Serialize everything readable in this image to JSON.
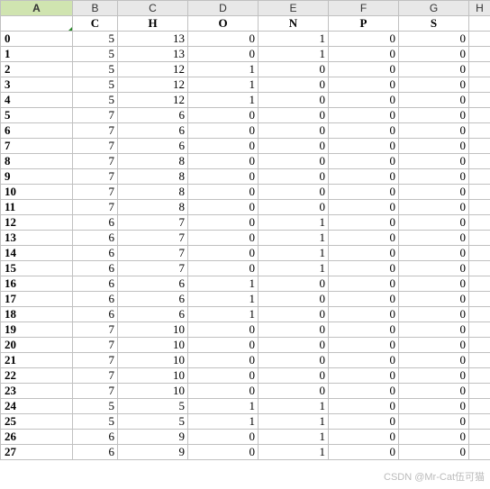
{
  "columns": [
    "A",
    "B",
    "C",
    "D",
    "E",
    "F",
    "G",
    "H"
  ],
  "data_headers": [
    "C",
    "H",
    "O",
    "N",
    "P",
    "S"
  ],
  "rows": [
    {
      "idx": "0",
      "v": [
        5,
        13,
        0,
        1,
        0,
        0
      ]
    },
    {
      "idx": "1",
      "v": [
        5,
        13,
        0,
        1,
        0,
        0
      ]
    },
    {
      "idx": "2",
      "v": [
        5,
        12,
        1,
        0,
        0,
        0
      ]
    },
    {
      "idx": "3",
      "v": [
        5,
        12,
        1,
        0,
        0,
        0
      ]
    },
    {
      "idx": "4",
      "v": [
        5,
        12,
        1,
        0,
        0,
        0
      ]
    },
    {
      "idx": "5",
      "v": [
        7,
        6,
        0,
        0,
        0,
        0
      ]
    },
    {
      "idx": "6",
      "v": [
        7,
        6,
        0,
        0,
        0,
        0
      ]
    },
    {
      "idx": "7",
      "v": [
        7,
        6,
        0,
        0,
        0,
        0
      ]
    },
    {
      "idx": "8",
      "v": [
        7,
        8,
        0,
        0,
        0,
        0
      ]
    },
    {
      "idx": "9",
      "v": [
        7,
        8,
        0,
        0,
        0,
        0
      ]
    },
    {
      "idx": "10",
      "v": [
        7,
        8,
        0,
        0,
        0,
        0
      ]
    },
    {
      "idx": "11",
      "v": [
        7,
        8,
        0,
        0,
        0,
        0
      ]
    },
    {
      "idx": "12",
      "v": [
        6,
        7,
        0,
        1,
        0,
        0
      ]
    },
    {
      "idx": "13",
      "v": [
        6,
        7,
        0,
        1,
        0,
        0
      ]
    },
    {
      "idx": "14",
      "v": [
        6,
        7,
        0,
        1,
        0,
        0
      ]
    },
    {
      "idx": "15",
      "v": [
        6,
        7,
        0,
        1,
        0,
        0
      ]
    },
    {
      "idx": "16",
      "v": [
        6,
        6,
        1,
        0,
        0,
        0
      ]
    },
    {
      "idx": "17",
      "v": [
        6,
        6,
        1,
        0,
        0,
        0
      ]
    },
    {
      "idx": "18",
      "v": [
        6,
        6,
        1,
        0,
        0,
        0
      ]
    },
    {
      "idx": "19",
      "v": [
        7,
        10,
        0,
        0,
        0,
        0
      ]
    },
    {
      "idx": "20",
      "v": [
        7,
        10,
        0,
        0,
        0,
        0
      ]
    },
    {
      "idx": "21",
      "v": [
        7,
        10,
        0,
        0,
        0,
        0
      ]
    },
    {
      "idx": "22",
      "v": [
        7,
        10,
        0,
        0,
        0,
        0
      ]
    },
    {
      "idx": "23",
      "v": [
        7,
        10,
        0,
        0,
        0,
        0
      ]
    },
    {
      "idx": "24",
      "v": [
        5,
        5,
        1,
        1,
        0,
        0
      ]
    },
    {
      "idx": "25",
      "v": [
        5,
        5,
        1,
        1,
        0,
        0
      ]
    },
    {
      "idx": "26",
      "v": [
        6,
        9,
        0,
        1,
        0,
        0
      ]
    },
    {
      "idx": "27",
      "v": [
        6,
        9,
        0,
        1,
        0,
        0
      ]
    }
  ],
  "watermark": "CSDN @Mr-Cat伍可猫"
}
